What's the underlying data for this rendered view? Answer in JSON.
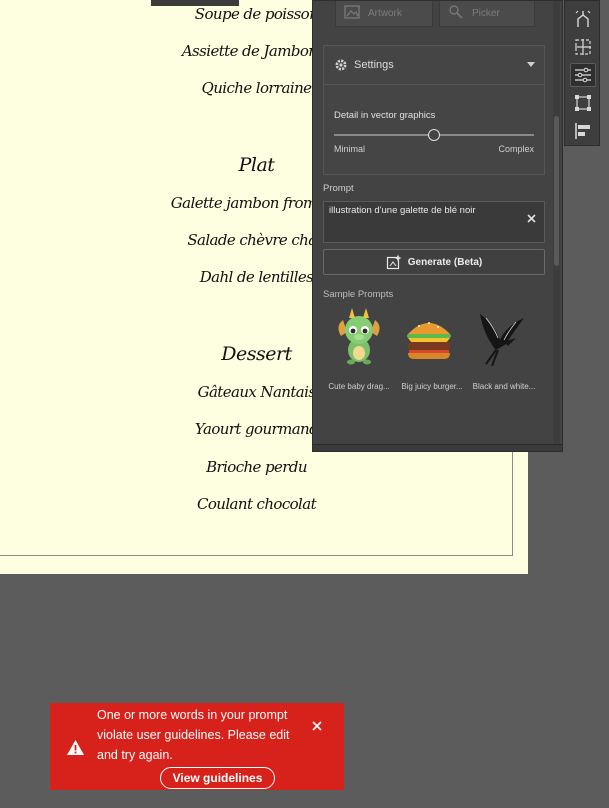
{
  "menu": {
    "items_top": [
      "Soupe de poisson",
      "Assiette de Jambon S",
      "Quiche lorraine"
    ],
    "section_plat": "Plat",
    "items_plat": [
      "Galette jambon fromage",
      "Salade chèvre chau",
      "Dahl de lentilles"
    ],
    "section_dessert": "Dessert",
    "items_dessert": [
      "Gâteaux Nantais",
      "Yaourt gourmand",
      "Brioche perdu",
      "Coulant chocolat"
    ]
  },
  "panel": {
    "mode_artwork": "Artwork",
    "mode_picker": "Picker",
    "settings_title": "Settings",
    "detail_label": "Detail in vector graphics",
    "slider_min_label": "Minimal",
    "slider_max_label": "Complex",
    "slider_value": 0.5,
    "prompt_label": "Prompt",
    "prompt_value": "illustration d'une galette de blé noir",
    "generate_label": "Generate (Beta)",
    "samples_title": "Sample Prompts",
    "samples": [
      {
        "label": "Cute baby drag...",
        "icon": "dragon-thumbnail"
      },
      {
        "label": "Big juicy burger...",
        "icon": "burger-thumbnail"
      },
      {
        "label": "Black and white...",
        "icon": "bird-thumbnail"
      }
    ]
  },
  "toolbar": {
    "tools": [
      "text-to-vector-icon",
      "align-distribute-icon",
      "properties-icon",
      "transform-icon",
      "align-left-icon"
    ]
  },
  "toast": {
    "message": "One or more words in your prompt violate user guidelines. Please edit and try again.",
    "button_label": "View guidelines"
  },
  "colors": {
    "canvas_bg": "#5c5c5c",
    "document_bg": "#fefee0",
    "panel_bg": "#434343",
    "toast_bg": "#d7221b"
  }
}
